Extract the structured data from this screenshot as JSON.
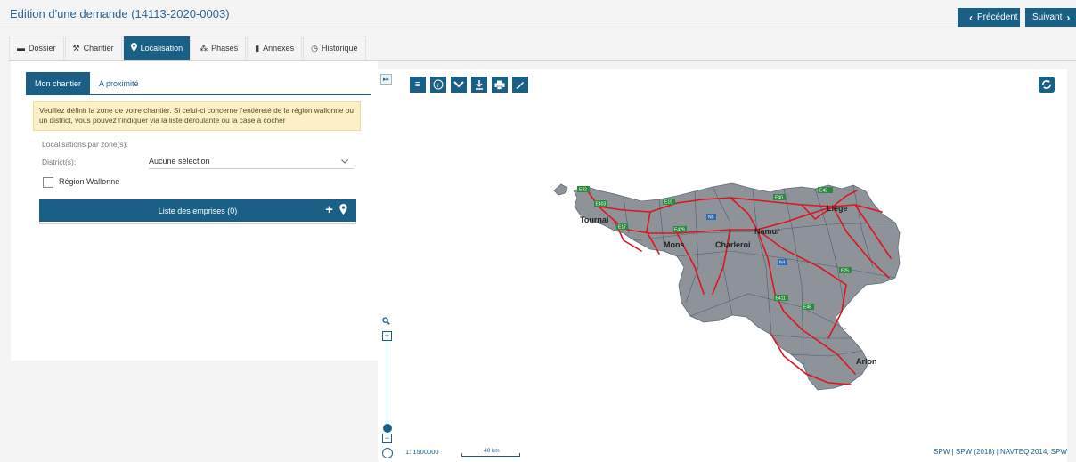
{
  "header": {
    "title": "Edition d'une demande (14113-2020-0003)",
    "prev_label": "Précédent",
    "next_label": "Suivant"
  },
  "tabs": [
    {
      "label": "Dossier",
      "icon": "folder-icon"
    },
    {
      "label": "Chantier",
      "icon": "worker-icon"
    },
    {
      "label": "Localisation",
      "icon": "map-marker-icon",
      "active": true
    },
    {
      "label": "Phases",
      "icon": "phases-icon"
    },
    {
      "label": "Annexes",
      "icon": "file-icon"
    },
    {
      "label": "Historique",
      "icon": "clock-icon"
    }
  ],
  "panel": {
    "subtabs": [
      "Mon chantier",
      "A proximité"
    ],
    "notice": "Veuillez définir la zone de votre chantier. Si celui-ci concerne l'entièreté de la région wallonne ou un district, vous pouvez l'indiquer via la liste déroulante ou la case à cocher",
    "zone_label": "Localisations par zone(s):",
    "district_label": "District(s):",
    "district_value": "Aucune sélection",
    "region_label": "Région Wallonne",
    "region_checked": false,
    "emprises_label": "Liste des emprises (0)"
  },
  "map": {
    "tools": [
      "menu-icon",
      "info-icon",
      "chevron-down-icon",
      "download-icon",
      "print-icon",
      "pencil-icon"
    ],
    "cities": [
      "Tournai",
      "Mons",
      "Charleroi",
      "Namur",
      "Liège",
      "Arlon"
    ],
    "roads": [
      "E42",
      "E403",
      "E17",
      "E19",
      "E429",
      "N5",
      "N4",
      "E40",
      "E411",
      "E25",
      "E46",
      "E42"
    ],
    "scale_text": "1: 1500000",
    "scale_bar": "40 km",
    "attribution": "SPW | SPW (2018) | NAVTEQ 2014, SPW",
    "colors": {
      "accent": "#1a5f86",
      "road": "#e0141e",
      "land": "#8d9398",
      "road_shield": "#2b8a3e"
    }
  }
}
